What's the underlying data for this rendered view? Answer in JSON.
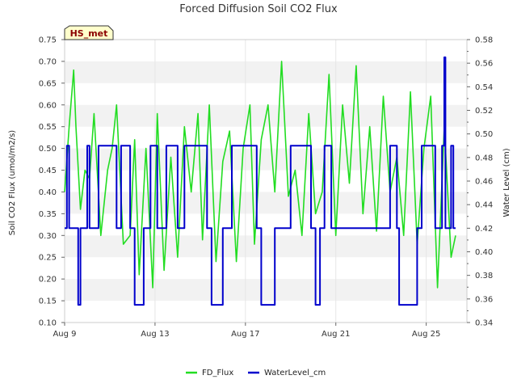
{
  "chart_data": {
    "type": "line",
    "title": "Forced Diffusion Soil CO2 Flux",
    "site_label": "HS_met",
    "ylabel": "Soil CO2 Flux (umol/m2/s)",
    "y2label": "Water Level (cm)",
    "xlabel": "",
    "x_unit": "day of August",
    "xlim": [
      9,
      26.8
    ],
    "ylim": [
      0.1,
      0.75
    ],
    "y2lim": [
      0.34,
      0.58
    ],
    "x_ticks": [
      {
        "value": 9,
        "label": "Aug 9"
      },
      {
        "value": 13,
        "label": "Aug 13"
      },
      {
        "value": 17,
        "label": "Aug 17"
      },
      {
        "value": 21,
        "label": "Aug 21"
      },
      {
        "value": 25,
        "label": "Aug 25"
      }
    ],
    "y_ticks": [
      "0.10",
      "0.15",
      "0.20",
      "0.25",
      "0.30",
      "0.35",
      "0.40",
      "0.45",
      "0.50",
      "0.55",
      "0.60",
      "0.65",
      "0.70",
      "0.75"
    ],
    "y2_ticks": [
      "0.34",
      "0.36",
      "0.38",
      "0.40",
      "0.42",
      "0.44",
      "0.46",
      "0.48",
      "0.50",
      "0.52",
      "0.54",
      "0.56",
      "0.58"
    ],
    "grid": "horizontal bands",
    "legend_position": "bottom-center",
    "series": [
      {
        "name": "FD_Flux",
        "axis": "left",
        "color": "#22dd22",
        "x": [
          9.0,
          9.2,
          9.4,
          9.5,
          9.7,
          9.9,
          10.1,
          10.3,
          10.6,
          10.9,
          11.1,
          11.3,
          11.6,
          11.9,
          12.1,
          12.3,
          12.6,
          12.9,
          13.1,
          13.4,
          13.7,
          14.0,
          14.3,
          14.6,
          14.9,
          15.1,
          15.4,
          15.7,
          16.0,
          16.3,
          16.6,
          16.9,
          17.2,
          17.4,
          17.7,
          18.0,
          18.3,
          18.6,
          18.9,
          19.2,
          19.5,
          19.8,
          20.1,
          20.4,
          20.7,
          21.0,
          21.3,
          21.6,
          21.9,
          22.2,
          22.5,
          22.8,
          23.1,
          23.4,
          23.7,
          24.0,
          24.3,
          24.6,
          24.9,
          25.2,
          25.5,
          25.8,
          26.1,
          26.3
        ],
        "y": [
          0.4,
          0.55,
          0.68,
          0.55,
          0.36,
          0.45,
          0.43,
          0.58,
          0.3,
          0.45,
          0.5,
          0.6,
          0.28,
          0.3,
          0.52,
          0.21,
          0.5,
          0.18,
          0.58,
          0.22,
          0.48,
          0.25,
          0.55,
          0.4,
          0.58,
          0.29,
          0.6,
          0.24,
          0.47,
          0.54,
          0.24,
          0.5,
          0.6,
          0.28,
          0.52,
          0.6,
          0.4,
          0.7,
          0.39,
          0.45,
          0.3,
          0.58,
          0.35,
          0.4,
          0.67,
          0.3,
          0.6,
          0.42,
          0.69,
          0.35,
          0.55,
          0.31,
          0.62,
          0.4,
          0.48,
          0.3,
          0.63,
          0.28,
          0.5,
          0.62,
          0.18,
          0.55,
          0.25,
          0.3
        ]
      },
      {
        "name": "WaterLevel_cm",
        "axis": "right",
        "color": "#0000cc",
        "x": [
          9.0,
          9.1,
          9.1,
          9.2,
          9.2,
          9.6,
          9.6,
          9.7,
          9.7,
          10.0,
          10.0,
          10.1,
          10.1,
          10.5,
          10.5,
          11.3,
          11.3,
          11.5,
          11.5,
          11.9,
          11.9,
          12.1,
          12.1,
          12.5,
          12.5,
          12.8,
          12.8,
          13.1,
          13.1,
          13.5,
          13.5,
          14.0,
          14.0,
          14.3,
          14.3,
          15.3,
          15.3,
          15.5,
          15.5,
          16.0,
          16.0,
          16.4,
          16.4,
          17.5,
          17.5,
          17.7,
          17.7,
          18.3,
          18.3,
          19.0,
          19.0,
          19.9,
          19.9,
          20.1,
          20.1,
          20.3,
          20.3,
          20.5,
          20.5,
          20.8,
          20.8,
          21.3,
          21.3,
          23.4,
          23.4,
          23.7,
          23.7,
          23.8,
          23.8,
          24.6,
          24.6,
          24.8,
          24.8,
          25.4,
          25.4,
          25.7,
          25.7,
          25.8,
          25.8,
          25.85,
          25.85,
          26.1,
          26.1,
          26.2,
          26.2,
          26.3
        ],
        "y": [
          0.42,
          0.42,
          0.49,
          0.49,
          0.42,
          0.42,
          0.355,
          0.355,
          0.42,
          0.42,
          0.49,
          0.49,
          0.42,
          0.42,
          0.49,
          0.49,
          0.42,
          0.42,
          0.49,
          0.49,
          0.42,
          0.42,
          0.355,
          0.355,
          0.42,
          0.42,
          0.49,
          0.49,
          0.42,
          0.42,
          0.49,
          0.49,
          0.42,
          0.42,
          0.49,
          0.49,
          0.42,
          0.42,
          0.355,
          0.355,
          0.42,
          0.42,
          0.49,
          0.49,
          0.42,
          0.42,
          0.355,
          0.355,
          0.42,
          0.42,
          0.49,
          0.49,
          0.42,
          0.42,
          0.355,
          0.355,
          0.42,
          0.42,
          0.49,
          0.49,
          0.42,
          0.42,
          0.42,
          0.42,
          0.49,
          0.49,
          0.42,
          0.42,
          0.355,
          0.355,
          0.42,
          0.42,
          0.49,
          0.49,
          0.42,
          0.42,
          0.49,
          0.49,
          0.565,
          0.565,
          0.42,
          0.42,
          0.49,
          0.49,
          0.42,
          0.42
        ]
      }
    ]
  }
}
